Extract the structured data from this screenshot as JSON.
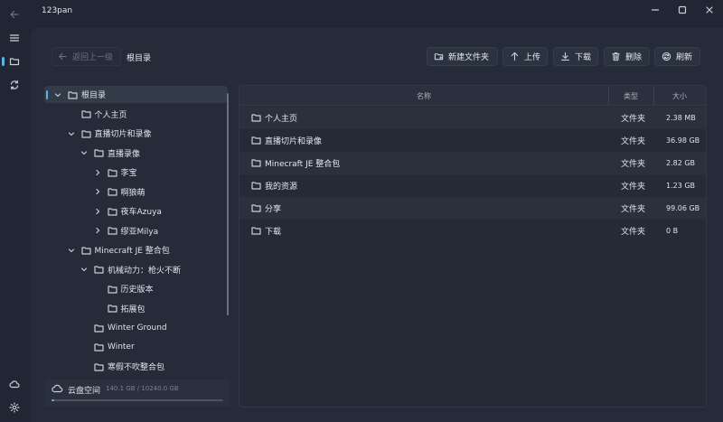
{
  "window": {
    "title": "123pan"
  },
  "toolbar": {
    "back_label": "返回上一级",
    "breadcrumb": "根目录",
    "new_folder": "新建文件夹",
    "upload": "上传",
    "download": "下载",
    "delete": "删除",
    "refresh": "刷新"
  },
  "tree": [
    {
      "label": "根目录",
      "depth": 0,
      "chevron": "down",
      "selected": true
    },
    {
      "label": "个人主页",
      "depth": 1,
      "chevron": "none"
    },
    {
      "label": "直播切片和录像",
      "depth": 1,
      "chevron": "down"
    },
    {
      "label": "直播录像",
      "depth": 2,
      "chevron": "down"
    },
    {
      "label": "李宝",
      "depth": 3,
      "chevron": "right"
    },
    {
      "label": "啊狼萌",
      "depth": 3,
      "chevron": "right"
    },
    {
      "label": "夜车Azuya",
      "depth": 3,
      "chevron": "right"
    },
    {
      "label": "缪亚Milya",
      "depth": 3,
      "chevron": "right"
    },
    {
      "label": "Minecraft JE 整合包",
      "depth": 1,
      "chevron": "down"
    },
    {
      "label": "机械动力：枪火不断",
      "depth": 2,
      "chevron": "down"
    },
    {
      "label": "历史版本",
      "depth": 3,
      "chevron": "none"
    },
    {
      "label": "拓展包",
      "depth": 3,
      "chevron": "none"
    },
    {
      "label": "Winter Ground",
      "depth": 2,
      "chevron": "none"
    },
    {
      "label": "Winter",
      "depth": 2,
      "chevron": "none"
    },
    {
      "label": "寒假不吹整合包",
      "depth": 2,
      "chevron": "none"
    }
  ],
  "storage": {
    "label": "云盘空间",
    "value": "140.1 GB / 10240.0 GB",
    "used_fraction": 0.0137
  },
  "list": {
    "headers": {
      "name": "名称",
      "type": "类型",
      "size": "大小"
    },
    "rows": [
      {
        "name": "个人主页",
        "type": "文件夹",
        "size": "2.38 MB"
      },
      {
        "name": "直播切片和录像",
        "type": "文件夹",
        "size": "36.98 GB"
      },
      {
        "name": "Minecraft JE 整合包",
        "type": "文件夹",
        "size": "2.82 GB"
      },
      {
        "name": "我的资源",
        "type": "文件夹",
        "size": "1.23 GB"
      },
      {
        "name": "分享",
        "type": "文件夹",
        "size": "99.06 GB"
      },
      {
        "name": "下载",
        "type": "文件夹",
        "size": "0 B"
      }
    ]
  },
  "colors": {
    "accent": "#5ab4e8",
    "background": "#202633",
    "panel": "#252b38"
  }
}
